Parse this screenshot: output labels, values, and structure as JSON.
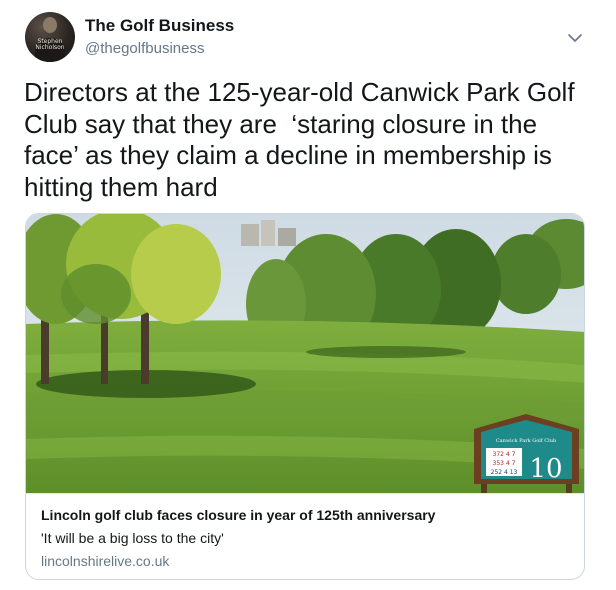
{
  "author": {
    "name": "The Golf Business",
    "handle": "@thegolfbusiness",
    "avatar_text": [
      "Stephen",
      "Nicholson"
    ]
  },
  "tweet": {
    "text": "Directors at the 125-year-old Canwick Park Golf Club say that they are  ‘staring closure in the face’ as they claim a decline in membership is  hitting them hard"
  },
  "card": {
    "title": "Lincoln golf club faces closure in year of 125th anniversary",
    "description": "'It will be a big loss to the city'",
    "domain": "lincolnshirelive.co.uk",
    "image": {
      "sign_header": "Canwick Park Golf Club",
      "hole_number": "10",
      "sign_scores": [
        "372",
        "4",
        "7",
        "353",
        "4",
        "7",
        "252",
        "4",
        "13"
      ]
    }
  },
  "icons": {
    "menu": "chevron-down-icon"
  },
  "colors": {
    "secondary_text": "#657786",
    "border": "#ccd6dd"
  }
}
